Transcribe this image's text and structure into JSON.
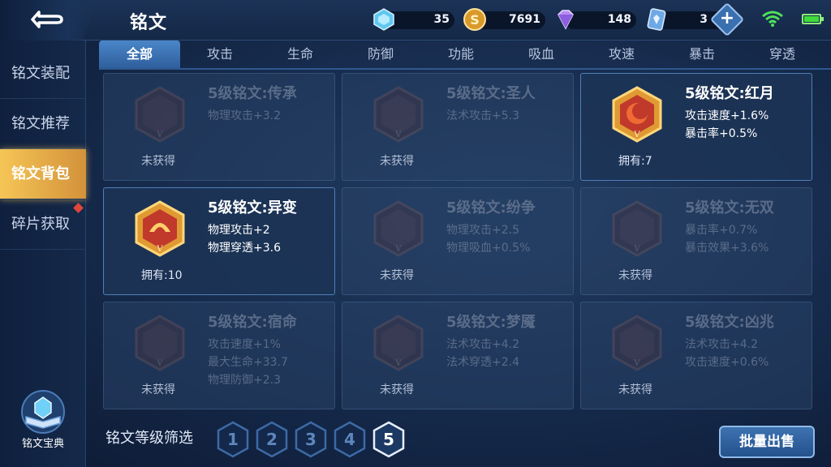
{
  "header": {
    "title": "铭文",
    "resources": [
      {
        "icon": "diamond-crystal-icon",
        "value": "35"
      },
      {
        "icon": "gold-coin-icon",
        "value": "7691"
      },
      {
        "icon": "purple-gem-icon",
        "value": "148"
      },
      {
        "icon": "inscription-card-icon",
        "value": "3"
      }
    ]
  },
  "sidebar": {
    "items": [
      {
        "label": "铭文装配"
      },
      {
        "label": "铭文推荐"
      },
      {
        "label": "铭文背包"
      },
      {
        "label": "碎片获取"
      }
    ],
    "codex_label": "铭文宝典"
  },
  "tabs": [
    {
      "label": "全部"
    },
    {
      "label": "攻击"
    },
    {
      "label": "生命"
    },
    {
      "label": "防御"
    },
    {
      "label": "功能"
    },
    {
      "label": "吸血"
    },
    {
      "label": "攻速"
    },
    {
      "label": "暴击"
    },
    {
      "label": "穿透"
    }
  ],
  "cards": [
    {
      "name": "5级铭文:传承",
      "stats": [
        "物理攻击+3.2"
      ],
      "status": "未获得",
      "owned": false
    },
    {
      "name": "5级铭文:圣人",
      "stats": [
        "法术攻击+5.3"
      ],
      "status": "未获得",
      "owned": false
    },
    {
      "name": "5级铭文:红月",
      "stats": [
        "攻击速度+1.6%",
        "暴击率+0.5%"
      ],
      "status": "拥有:7",
      "owned": true
    },
    {
      "name": "5级铭文:异变",
      "stats": [
        "物理攻击+2",
        "物理穿透+3.6"
      ],
      "status": "拥有:10",
      "owned": true
    },
    {
      "name": "5级铭文:纷争",
      "stats": [
        "物理攻击+2.5",
        "物理吸血+0.5%"
      ],
      "status": "未获得",
      "owned": false
    },
    {
      "name": "5级铭文:无双",
      "stats": [
        "暴击率+0.7%",
        "暴击效果+3.6%"
      ],
      "status": "未获得",
      "owned": false
    },
    {
      "name": "5级铭文:宿命",
      "stats": [
        "攻击速度+1%",
        "最大生命+33.7",
        "物理防御+2.3"
      ],
      "status": "未获得",
      "owned": false
    },
    {
      "name": "5级铭文:梦魇",
      "stats": [
        "法术攻击+4.2",
        "法术穿透+2.4"
      ],
      "status": "未获得",
      "owned": false
    },
    {
      "name": "5级铭文:凶兆",
      "stats": [
        "法术攻击+4.2",
        "攻击速度+0.6%"
      ],
      "status": "未获得",
      "owned": false
    }
  ],
  "bottom": {
    "filter_label": "铭文等级筛选",
    "levels": [
      "1",
      "2",
      "3",
      "4",
      "5"
    ],
    "sell_label": "批量出售"
  },
  "colors": {
    "accent_gold": "#f5c556",
    "owned_emblem": "#e6a23a",
    "locked_emblem": "#7a2f33",
    "tab_active": "#4a86c9"
  }
}
